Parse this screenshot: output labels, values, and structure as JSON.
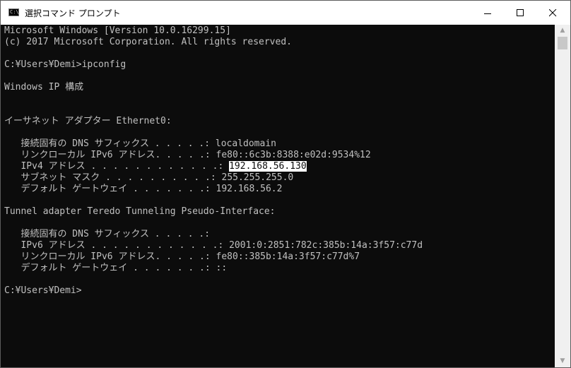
{
  "window": {
    "title": "選択コマンド プロンプト",
    "app_icon_text": "C:\\"
  },
  "console": {
    "lines": [
      "Microsoft Windows [Version 10.0.16299.15]",
      "(c) 2017 Microsoft Corporation. All rights reserved.",
      "",
      "C:¥Users¥Demi>ipconfig",
      "",
      "Windows IP 構成",
      "",
      "",
      "イーサネット アダプター Ethernet0:",
      "",
      "   接続固有の DNS サフィックス . . . . .: localdomain",
      "   リンクローカル IPv6 アドレス. . . . .: fe80::6c3b:8388:e02d:9534%12",
      "",
      "   サブネット マスク . . . . . . . . . .: 255.255.255.0",
      "   デフォルト ゲートウェイ . . . . . . .: 192.168.56.2",
      "",
      "Tunnel adapter Teredo Tunneling Pseudo-Interface:",
      "",
      "   接続固有の DNS サフィックス . . . . .:",
      "   IPv6 アドレス . . . . . . . . . . . .: 2001:0:2851:782c:385b:14a:3f57:c77d",
      "   リンクローカル IPv6 アドレス. . . . .: fe80::385b:14a:3f57:c77d%7",
      "   デフォルト ゲートウェイ . . . . . . .: ::",
      "",
      "C:¥Users¥Demi>"
    ],
    "ipv4_line_prefix": "   IPv4 アドレス . . . . . . . . . . . .: ",
    "ipv4_selected_value": "192.168.56.130"
  },
  "colors": {
    "console_bg": "#0c0c0c",
    "console_text": "#c0c0c0",
    "selection_bg": "#ffffff",
    "selection_text": "#0c0c0c"
  },
  "icons": {
    "minimize": "minimize-icon",
    "maximize": "maximize-icon",
    "close": "close-icon",
    "scroll_up": "scroll-up-arrow-icon",
    "scroll_down": "scroll-down-arrow-icon"
  }
}
